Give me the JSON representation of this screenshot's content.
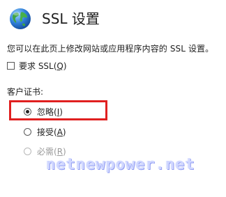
{
  "header": {
    "title": "SSL 设置",
    "icon": "globe-icon"
  },
  "description": "您可以在此页上修改网站或应用程序内容的 SSL 设置。",
  "require_ssl": {
    "label_prefix": "要求 SSL(",
    "label_accel": "Q",
    "label_suffix": ")",
    "checked": false
  },
  "client_certs": {
    "label": "客户证书:",
    "options": [
      {
        "label_prefix": "忽略(",
        "accel": "I",
        "label_suffix": ")",
        "selected": true,
        "enabled": true
      },
      {
        "label_prefix": "接受(",
        "accel": "A",
        "label_suffix": ")",
        "selected": false,
        "enabled": true
      },
      {
        "label_prefix": "必需(",
        "accel": "R",
        "label_suffix": ")",
        "selected": false,
        "enabled": false
      }
    ]
  },
  "highlight_color": "#e02020",
  "watermark": "netnewpower.net"
}
